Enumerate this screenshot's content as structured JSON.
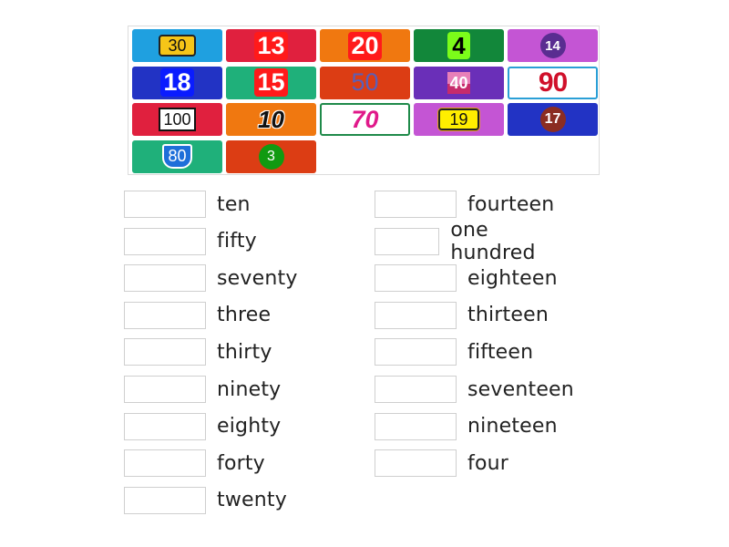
{
  "tiles": [
    {
      "value": "30",
      "bg": "#1fa0e0",
      "style": "s-yellow-box",
      "row": 0,
      "col": 0
    },
    {
      "value": "13",
      "bg": "#e0203e",
      "style": "s-red-box",
      "row": 0,
      "col": 1
    },
    {
      "value": "20",
      "bg": "#f07810",
      "style": "s-red-box",
      "row": 0,
      "col": 2
    },
    {
      "value": "4",
      "bg": "#12873a",
      "style": "s-green-box",
      "row": 0,
      "col": 3
    },
    {
      "value": "14",
      "bg": "#c455d4",
      "style": "s-purple-circle",
      "row": 0,
      "col": 4
    },
    {
      "value": "18",
      "bg": "#2233c4",
      "style": "s-blue-box",
      "row": 1,
      "col": 0
    },
    {
      "value": "15",
      "bg": "#1fb07a",
      "style": "s-red-box",
      "row": 1,
      "col": 1
    },
    {
      "value": "50",
      "bg": "#dc3d14",
      "style": "s-plain-blue",
      "row": 1,
      "col": 2
    },
    {
      "value": "40",
      "bg": "#6a2fb8",
      "style": "s-pink-photo",
      "row": 1,
      "col": 3
    },
    {
      "value": "90",
      "bg": "#ffffff",
      "border": "#2a9fd6",
      "style": "s-red-bold",
      "row": 1,
      "col": 4
    },
    {
      "value": "100",
      "bg": "#e0203e",
      "style": "s-white-sign",
      "row": 2,
      "col": 0
    },
    {
      "value": "10",
      "bg": "#f07810",
      "style": "s-italic-black",
      "row": 2,
      "col": 1
    },
    {
      "value": "70",
      "bg": "#ffffff",
      "border": "#1f8a4a",
      "style": "s-pink-bold",
      "row": 2,
      "col": 2
    },
    {
      "value": "19",
      "bg": "#c455d4",
      "style": "s-yellow-sign",
      "row": 2,
      "col": 3
    },
    {
      "value": "17",
      "bg": "#2233c4",
      "style": "s-brown-circle",
      "row": 2,
      "col": 4
    },
    {
      "value": "80",
      "bg": "#1fb07a",
      "style": "s-shield",
      "row": 3,
      "col": 0
    },
    {
      "value": "3",
      "bg": "#dc3d14",
      "style": "s-green-circle",
      "row": 3,
      "col": 1
    }
  ],
  "answers": {
    "left": [
      "ten",
      "fifty",
      "seventy",
      "three",
      "thirty",
      "ninety",
      "eighty",
      "forty",
      "twenty"
    ],
    "right": [
      "fourteen",
      "one hundred",
      "eighteen",
      "thirteen",
      "fifteen",
      "seventeen",
      "nineteen",
      "four"
    ]
  }
}
